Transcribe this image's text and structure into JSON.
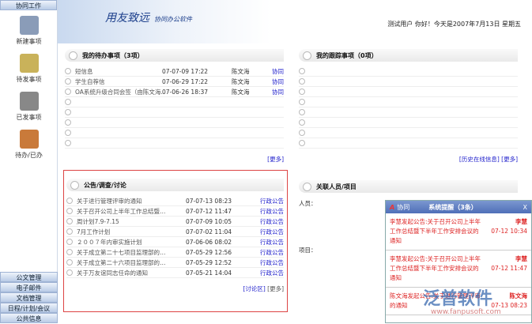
{
  "sidebar": {
    "header": "协同工作",
    "items": [
      {
        "label": "新建事项",
        "color": "#8a9cb8"
      },
      {
        "label": "待发事项",
        "color": "#c9b25a"
      },
      {
        "label": "已发事项",
        "color": "#888"
      },
      {
        "label": "待办/已办",
        "color": "#c97a3a"
      }
    ],
    "bottom": [
      "公文管理",
      "电子邮件",
      "文档管理",
      "日程/计划/会议",
      "公共信息"
    ]
  },
  "header": {
    "logo": "用友致远",
    "product": "协同办公软件",
    "greeting": "测试用户  你好！今天是2007年7月13日  星期五"
  },
  "todo": {
    "title": "我的待办事项（3项）",
    "rows": [
      {
        "title": "短信息",
        "date": "07-07-09 17:22",
        "user": "陈文海",
        "type": "协同"
      },
      {
        "title": "学生自荐信",
        "date": "07-06-29 17:22",
        "user": "陈文海",
        "type": "协同"
      },
      {
        "title": "OA系统升级合同会签（由陈文海…",
        "date": "07-06-26 18:37",
        "user": "陈文海",
        "type": "协同"
      }
    ],
    "empty_rows": 5,
    "more": "[更多]"
  },
  "track": {
    "title": "我的跟踪事项（0项）",
    "empty_rows": 8,
    "history": "[历史在线信息]",
    "more": "[更多]"
  },
  "notice": {
    "title": "公告/调查/讨论",
    "rows": [
      {
        "title": "关于进行管理评审的通知",
        "date": "07-07-13 08:23",
        "type": "行政公告"
      },
      {
        "title": "关于召开公司上半年工作总结暨…",
        "date": "07-07-12 11:47",
        "type": "行政公告"
      },
      {
        "title": "周计划7.9-7.15",
        "date": "07-07-09 10:05",
        "type": "行政公告"
      },
      {
        "title": "7月工作计划",
        "date": "07-07-02 11:04",
        "type": "行政公告"
      },
      {
        "title": "２００７年内审实施计划",
        "date": "07-06-06 08:02",
        "type": "行政公告"
      },
      {
        "title": "关于成立第二十七项目监理部的…",
        "date": "07-05-29 12:56",
        "type": "行政公告"
      },
      {
        "title": "关于成立第二十六项目监理部的…",
        "date": "07-05-29 12:52",
        "type": "行政公告"
      },
      {
        "title": "关于万友谊同志任命的通知",
        "date": "07-05-21 14:04",
        "type": "行政公告"
      }
    ],
    "forum": "[讨论区]",
    "more": "[更多]"
  },
  "related": {
    "title": "关联人员/项目",
    "people": "人员：",
    "project": "项目："
  },
  "popup": {
    "app": "协同",
    "title": "系统提醒（3条）",
    "close": "X",
    "items": [
      {
        "text": "李慧发起公告:关于召开公司上半年工作总结暨下半年工作安排会议的通知",
        "sender": "李慧",
        "time": "07-12 10:34"
      },
      {
        "text": "李慧发起公告:关于召开公司上半年工作总结暨下半年工作安排会议的通知",
        "sender": "李慧",
        "time": "07-12 11:47"
      },
      {
        "text": "陈文海发起公告:关于进行管理评审的通知",
        "sender": "陈文海",
        "time": "07-13 08:23"
      }
    ]
  },
  "watermark": {
    "brand": "泛普软件",
    "url": "www.fanpusoft.com"
  }
}
